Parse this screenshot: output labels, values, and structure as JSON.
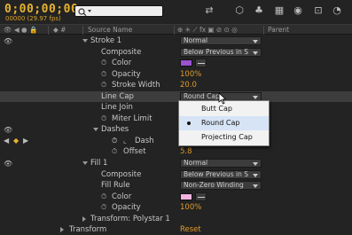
{
  "header": {
    "timecode": "0;00;00;00",
    "fps_text": "00000 (29.97 fps)",
    "search": {
      "value": "",
      "placeholder": ""
    }
  },
  "columns": {
    "source_name": "Source Name",
    "parent": "Parent"
  },
  "layers": {
    "stroke": {
      "label": "Stroke 1",
      "blend": "Normal",
      "composite": {
        "label": "Composite",
        "value": "Below Previous in S"
      },
      "color": {
        "label": "Color",
        "swatch": "#9a52d0"
      },
      "opacity": {
        "label": "Opacity",
        "value": "100%"
      },
      "stroke_width": {
        "label": "Stroke Width",
        "value": "20.0"
      },
      "line_cap": {
        "label": "Line Cap",
        "value": "Round Cap"
      },
      "line_join": {
        "label": "Line Join"
      },
      "miter_limit": {
        "label": "Miter Limit"
      },
      "dashes": {
        "label": "Dashes"
      },
      "dash": {
        "label": "Dash"
      },
      "offset": {
        "label": "Offset",
        "value": "5.8"
      }
    },
    "fill": {
      "label": "Fill 1",
      "blend": "Normal",
      "composite": {
        "label": "Composite",
        "value": "Below Previous in S"
      },
      "fill_rule": {
        "label": "Fill Rule",
        "value": "Non-Zero Winding"
      },
      "color": {
        "label": "Color",
        "swatch": "#f3b2df"
      },
      "opacity": {
        "label": "Opacity",
        "value": "100%"
      }
    },
    "transform_polystar": {
      "label": "Transform: Polystar 1"
    },
    "transform": {
      "label": "Transform",
      "reset": "Reset"
    }
  },
  "line_cap_menu": {
    "options": [
      "Butt Cap",
      "Round Cap",
      "Projecting Cap"
    ],
    "selected": "Round Cap"
  },
  "colors": {
    "timecode": "#e8b330",
    "value": "#e09a2b",
    "background": "#232323"
  }
}
